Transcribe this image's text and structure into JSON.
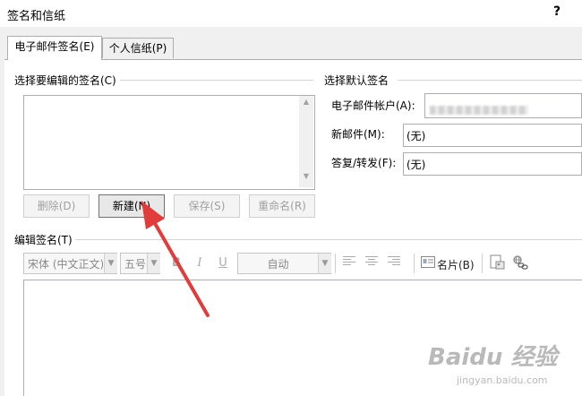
{
  "window": {
    "title": "签名和信纸",
    "help": "?"
  },
  "tabs": [
    {
      "label": "电子邮件签名(E)",
      "active": true
    },
    {
      "label": "个人信纸(P)",
      "active": false
    }
  ],
  "select_signature": {
    "label": "选择要编辑的签名(C)",
    "buttons": {
      "delete": "删除(D)",
      "new": "新建(N)",
      "save": "保存(S)",
      "rename": "重命名(R)"
    }
  },
  "default_signature": {
    "label": "选择默认签名",
    "account_label": "电子邮件帐户(A):",
    "new_mail_label": "新邮件(M):",
    "new_mail_value": "(无)",
    "reply_label": "答复/转发(F):",
    "reply_value": "(无)"
  },
  "edit_signature": {
    "label": "编辑签名(T)",
    "font": "宋体 (中文正文)",
    "size": "五号",
    "bold": "B",
    "italic": "I",
    "underline": "U",
    "color": "自动",
    "business_card": "名片(B)"
  },
  "watermark": {
    "brand": "Baidu 经验",
    "url": "jingyan.baidu.com"
  },
  "colors": {
    "arrow": "#e03c3c",
    "accent": "#0078d7"
  }
}
